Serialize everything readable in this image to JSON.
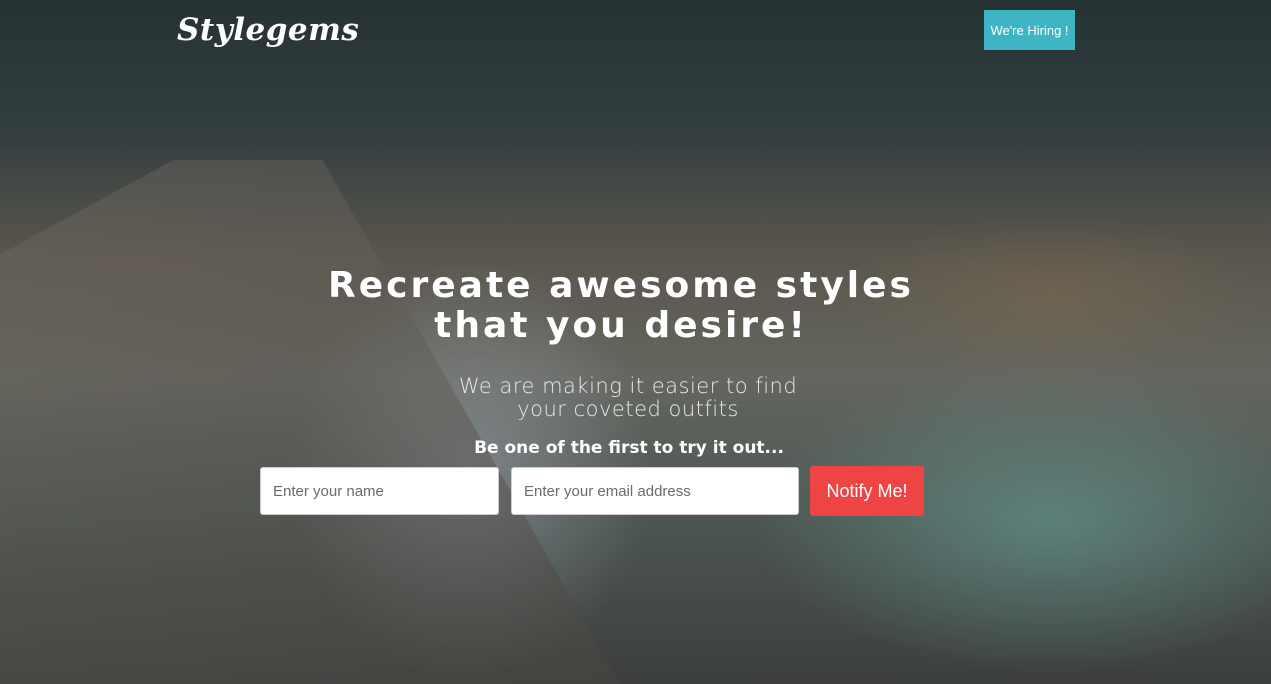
{
  "brand": {
    "logo_text": "Stylegems"
  },
  "header": {
    "hiring_label": "We're Hiring !"
  },
  "hero": {
    "headline_line1": "Recreate awesome styles",
    "headline_line2": "that you desire!",
    "subheadline_line1": "We are making it easier to find",
    "subheadline_line2": "your coveted outfits",
    "cta_text": "Be one of the first to try it out..."
  },
  "form": {
    "name_placeholder": "Enter your name",
    "name_value": "",
    "email_placeholder": "Enter your email address",
    "email_value": "",
    "submit_label": "Notify Me!"
  },
  "colors": {
    "hiring_button": "#3fb4c2",
    "notify_button": "#ef4444",
    "text": "#ffffff"
  }
}
